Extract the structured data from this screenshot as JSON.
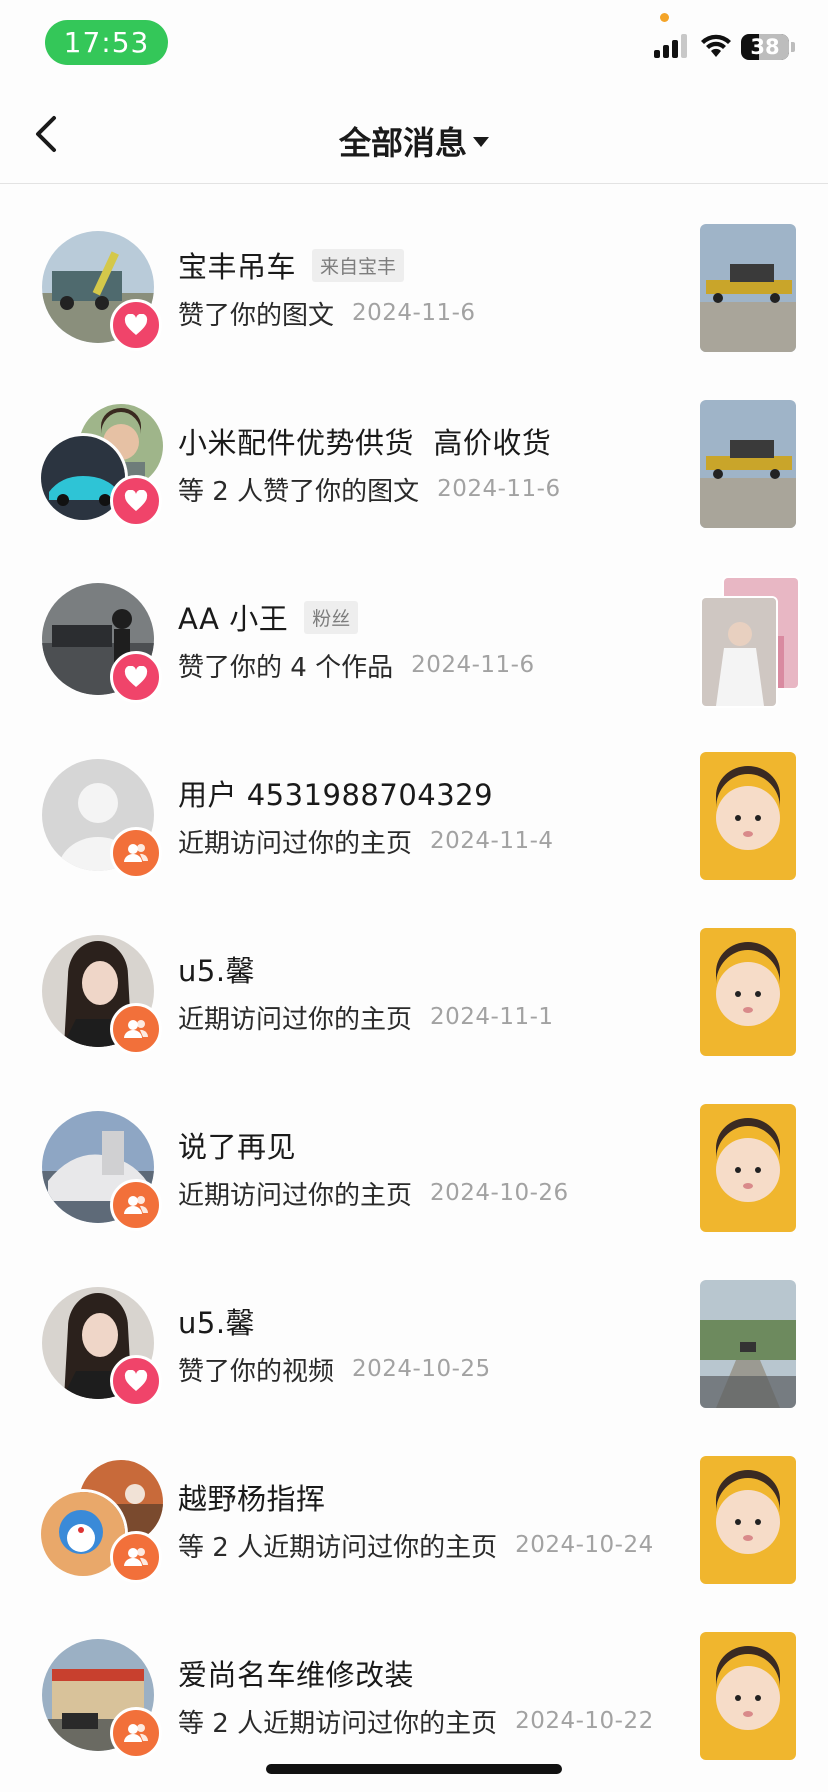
{
  "status_bar": {
    "time": "17:53",
    "battery": "38"
  },
  "header": {
    "title": "全部消息"
  },
  "notifications": [
    {
      "name": "宝丰吊车",
      "tag": "来自宝丰",
      "action": "赞了你的图文",
      "date": "2024-11-6",
      "badge": "heart-icon"
    },
    {
      "name": "小米配件优势供货  高价收货",
      "tag": "",
      "action": "等 2 人赞了你的图文",
      "date": "2024-11-6",
      "badge": "heart-icon"
    },
    {
      "name": "AA 小王",
      "tag": "粉丝",
      "action": "赞了你的 4 个作品",
      "date": "2024-11-6",
      "badge": "heart-icon"
    },
    {
      "name": "用户 4531988704329",
      "tag": "",
      "action": "近期访问过你的主页",
      "date": "2024-11-4",
      "badge": "visitors-icon"
    },
    {
      "name": "u5.馨",
      "tag": "",
      "action": "近期访问过你的主页",
      "date": "2024-11-1",
      "badge": "visitors-icon"
    },
    {
      "name": "说了再见",
      "tag": "",
      "action": "近期访问过你的主页",
      "date": "2024-10-26",
      "badge": "visitors-icon"
    },
    {
      "name": "u5.馨",
      "tag": "",
      "action": "赞了你的视频",
      "date": "2024-10-25",
      "badge": "heart-icon"
    },
    {
      "name": "越野杨指挥",
      "tag": "",
      "action": "等 2 人近期访问过你的主页",
      "date": "2024-10-24",
      "badge": "visitors-icon"
    },
    {
      "name": "爱尚名车维修改装",
      "tag": "",
      "action": "等 2 人近期访问过你的主页",
      "date": "2024-10-22",
      "badge": "visitors-icon"
    }
  ],
  "colors": {
    "like_badge": "#f0446a",
    "visit_badge": "#f2703a",
    "time_pill": "#34c759"
  }
}
